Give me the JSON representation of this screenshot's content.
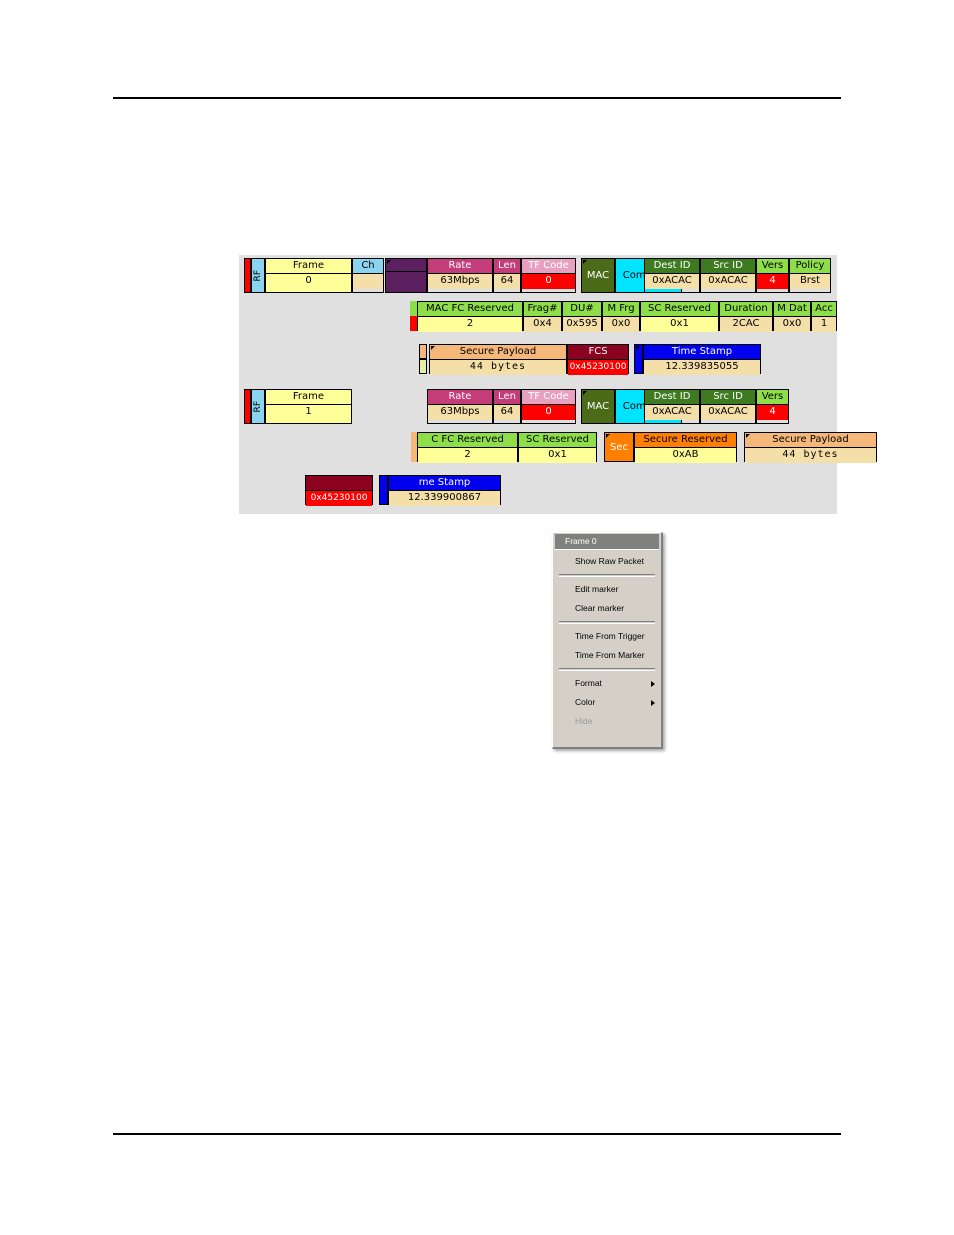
{
  "page": {
    "background": "#ffffff",
    "rule_color": "#000000"
  },
  "analyzer": {
    "panel_background": "#e0e0e0",
    "frames": [
      {
        "name": "frame-0",
        "rf": {
          "label": "RF",
          "color": "#8ad4f0"
        },
        "rows": [
          {
            "name": "row-phy-mac",
            "segments": [
              {
                "name": "frame",
                "header": "Frame",
                "value": "0",
                "header_color": "#ffff99",
                "value_color": "#ffff99"
              },
              {
                "name": "channel",
                "header": "Ch",
                "value": "",
                "header_color": "#8ad4f0",
                "value_color": "#f5dfa8"
              },
              {
                "name": "phy-tab",
                "header": "",
                "value": "",
                "header_color": "#5c2060",
                "value_color": "#5c2060"
              },
              {
                "name": "rate",
                "header": "Rate",
                "value": "63Mbps",
                "header_color": "#c43c7a",
                "value_color": "#f5dfa8"
              },
              {
                "name": "len",
                "header": "Len",
                "value": "64",
                "header_color": "#c43c7a",
                "value_color": "#f5dfa8"
              },
              {
                "name": "tf-code",
                "header": "TF Code",
                "value": "0",
                "header_color": "#e8a0c0",
                "value_color": "#ff0000"
              },
              {
                "name": "mac",
                "header": "MAC",
                "value": "",
                "header_color": "#4c6b18",
                "value_color": "#4c6b18"
              },
              {
                "name": "command",
                "header": "Command",
                "value": "",
                "header_color": "#00e5ff",
                "value_color": "#00e5ff"
              },
              {
                "name": "dest-id",
                "header": "Dest ID",
                "value": "0xACAC",
                "header_color": "#3d7a20",
                "value_color": "#f5dfa8"
              },
              {
                "name": "src-id",
                "header": "Src ID",
                "value": "0xACAC",
                "header_color": "#3d7a20",
                "value_color": "#f5dfa8"
              },
              {
                "name": "vers",
                "header": "Vers",
                "value": "4",
                "header_color": "#8ede4a",
                "value_color": "#ff0000"
              },
              {
                "name": "policy",
                "header": "Policy",
                "value": "Brst",
                "header_color": "#8ede4a",
                "value_color": "#f5dfa8"
              }
            ]
          },
          {
            "name": "row-mac-fields",
            "segments": [
              {
                "name": "mac-fc-reserved",
                "header": "MAC FC Reserved",
                "value": "2",
                "header_color": "#8ede4a",
                "value_color": "#ffff99"
              },
              {
                "name": "frag-num",
                "header": "Frag#",
                "value": "0x4",
                "header_color": "#8ede4a",
                "value_color": "#f5dfa8"
              },
              {
                "name": "du-num",
                "header": "DU#",
                "value": "0x595",
                "header_color": "#8ede4a",
                "value_color": "#f5dfa8"
              },
              {
                "name": "m-frg",
                "header": "M Frg",
                "value": "0x0",
                "header_color": "#8ede4a",
                "value_color": "#f5dfa8"
              },
              {
                "name": "sc-reserved",
                "header": "SC Reserved",
                "value": "0x1",
                "header_color": "#8ede4a",
                "value_color": "#ffff99"
              },
              {
                "name": "duration",
                "header": "Duration",
                "value": "2CAC",
                "header_color": "#8ede4a",
                "value_color": "#f5dfa8"
              },
              {
                "name": "m-dat",
                "header": "M Dat",
                "value": "0x0",
                "header_color": "#8ede4a",
                "value_color": "#f5dfa8"
              },
              {
                "name": "acc",
                "header": "Acc",
                "value": "1",
                "header_color": "#8ede4a",
                "value_color": "#f5dfa8"
              }
            ]
          },
          {
            "name": "row-payload",
            "segments": [
              {
                "name": "secure-payload",
                "header": "Secure Payload",
                "value": "44 bytes",
                "header_color": "#f5b77a",
                "value_color": "#f5dfa8"
              },
              {
                "name": "fcs",
                "header": "FCS",
                "value": "0x45230100",
                "header_color": "#8c0020",
                "value_color": "#ff0000"
              },
              {
                "name": "time-stamp",
                "header": "Time Stamp",
                "value": "12.339835055",
                "header_color": "#0000ee",
                "value_color": "#f5dfa8"
              }
            ]
          }
        ]
      },
      {
        "name": "frame-1",
        "rf": {
          "label": "RF",
          "color": "#8ad4f0"
        },
        "rows": [
          {
            "name": "row-phy-mac",
            "segments": [
              {
                "name": "frame",
                "header": "Frame",
                "value": "1",
                "header_color": "#ffff99",
                "value_color": "#ffff99"
              },
              {
                "name": "rate",
                "header": "Rate",
                "value": "63Mbps",
                "header_color": "#c43c7a",
                "value_color": "#f5dfa8"
              },
              {
                "name": "len",
                "header": "Len",
                "value": "64",
                "header_color": "#c43c7a",
                "value_color": "#f5dfa8"
              },
              {
                "name": "tf-code",
                "header": "TF Code",
                "value": "0",
                "header_color": "#e8a0c0",
                "value_color": "#ff0000"
              },
              {
                "name": "mac",
                "header": "MAC",
                "value": "",
                "header_color": "#4c6b18",
                "value_color": "#4c6b18"
              },
              {
                "name": "command",
                "header": "Command",
                "value": "",
                "header_color": "#00e5ff",
                "value_color": "#00e5ff"
              },
              {
                "name": "dest-id",
                "header": "Dest ID",
                "value": "0xACAC",
                "header_color": "#3d7a20",
                "value_color": "#f5dfa8"
              },
              {
                "name": "src-id",
                "header": "Src ID",
                "value": "0xACAC",
                "header_color": "#3d7a20",
                "value_color": "#f5dfa8"
              },
              {
                "name": "vers",
                "header": "Vers",
                "value": "4",
                "header_color": "#8ede4a",
                "value_color": "#ff0000"
              }
            ]
          },
          {
            "name": "row-security",
            "segments": [
              {
                "name": "mac-fc-reserved",
                "header": "C FC Reserved",
                "value": "2",
                "header_color": "#8ede4a",
                "value_color": "#ffff99"
              },
              {
                "name": "sc-reserved",
                "header": "SC Reserved",
                "value": "0x1",
                "header_color": "#8ede4a",
                "value_color": "#ffff99"
              },
              {
                "name": "sec",
                "header": "Sec",
                "value": "",
                "header_color": "#ff8000",
                "value_color": "#ff8000"
              },
              {
                "name": "secure-reserved",
                "header": "Secure Reserved",
                "value": "0xAB",
                "header_color": "#ff8000",
                "value_color": "#ffff99"
              },
              {
                "name": "secure-payload",
                "header": "Secure Payload",
                "value": "44 bytes",
                "header_color": "#f5b77a",
                "value_color": "#f5dfa8"
              }
            ]
          },
          {
            "name": "row-fcs-time",
            "segments": [
              {
                "name": "fcs",
                "header": "",
                "value": "0x45230100",
                "header_color": "#8c0020",
                "value_color": "#ff0000"
              },
              {
                "name": "time-stamp",
                "header": "me Stamp",
                "value": "12.339900867",
                "header_color": "#0000ee",
                "value_color": "#f5dfa8"
              }
            ]
          }
        ]
      }
    ]
  },
  "context_menu": {
    "background": "#d4d0c8",
    "highlight_color": "#808080",
    "title": "Frame 0",
    "items": [
      {
        "name": "show-raw-packet",
        "label": "Show Raw Packet",
        "disabled": false,
        "submenu": false
      },
      {
        "name": "edit-marker",
        "label": "Edit marker",
        "disabled": false,
        "submenu": false
      },
      {
        "name": "clear-marker",
        "label": "Clear marker",
        "disabled": false,
        "submenu": false
      },
      {
        "name": "time-from-trigger",
        "label": "Time From Trigger",
        "disabled": false,
        "submenu": false
      },
      {
        "name": "time-from-marker",
        "label": "Time From Marker",
        "disabled": false,
        "submenu": false
      },
      {
        "name": "format",
        "label": "Format",
        "disabled": false,
        "submenu": true
      },
      {
        "name": "color",
        "label": "Color",
        "disabled": false,
        "submenu": true
      },
      {
        "name": "hide",
        "label": "Hide",
        "disabled": true,
        "submenu": false
      }
    ]
  }
}
